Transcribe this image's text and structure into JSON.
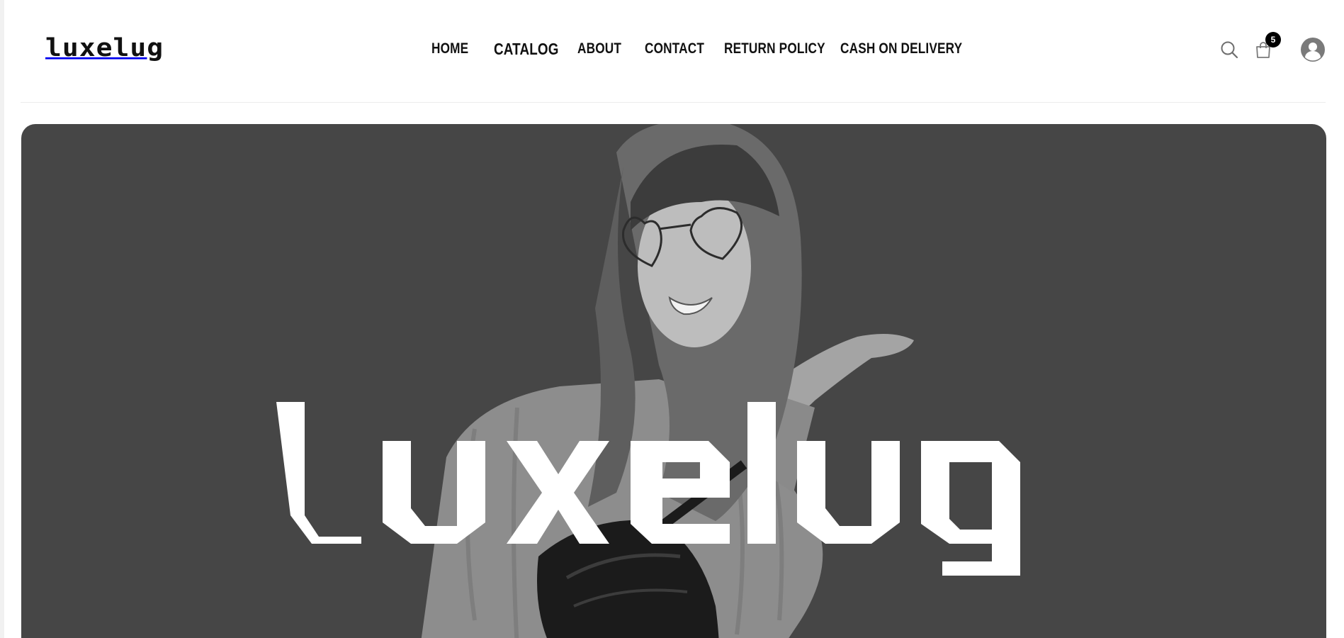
{
  "brand": {
    "logo_text": "luxelug",
    "hero_wordmark": "Luxelug"
  },
  "nav": {
    "items": [
      {
        "label": "HOME"
      },
      {
        "label": "CATALOG"
      },
      {
        "label": "ABOUT"
      },
      {
        "label": "CONTACT"
      },
      {
        "label": "RETURN POLICY"
      },
      {
        "label": "CASH ON DELIVERY"
      }
    ]
  },
  "header_icons": {
    "search": "search-icon",
    "cart": "shopping-bag-icon",
    "cart_count": "5",
    "account": "user-account-icon"
  },
  "colors": {
    "hero_background": "#464646",
    "text": "#111111",
    "badge": "#000000",
    "icon_gray": "#7a7a7a"
  }
}
